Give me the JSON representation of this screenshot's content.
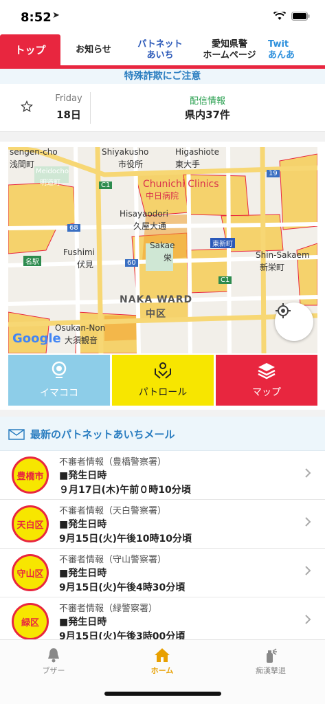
{
  "status": {
    "time": "8:52",
    "location_icon": "location-arrow-icon",
    "wifi_icon": "wifi-icon",
    "battery_icon": "battery-icon"
  },
  "tabs": [
    {
      "l1": "トップ",
      "l2": ""
    },
    {
      "l1": "お知らせ",
      "l2": ""
    },
    {
      "l1": "パトネット",
      "l2": "あいち"
    },
    {
      "l1": "愛知県警",
      "l2": "ホームページ"
    },
    {
      "l1": "Twit",
      "l2": "あんあ"
    }
  ],
  "alert": "特殊詐欺にご注意",
  "info": {
    "day": "Friday",
    "date": "18日",
    "delivery_label": "配信情報",
    "delivery_count": "県内37件"
  },
  "map": {
    "labels": {
      "sengen": "sengen-cho",
      "asama": "浅間町",
      "meidocho": "Meidocho",
      "meidocho_jp": "明道町",
      "shiyakusho": "Shiyakusho",
      "shiyakusho_jp": "市役所",
      "higashi": "Higashiote",
      "higashi_jp": "東大手",
      "chunichi": "Chunichi Clinics",
      "chunichi_jp": "中日病院",
      "c1": "C1",
      "r19": "19",
      "hisaya": "Hisayaodori",
      "hisaya_jp": "久屋大通",
      "r68": "68",
      "fushimi": "Fushimi",
      "fushimi_jp": "伏見",
      "sakae": "Sakae",
      "sakae_jp": "栄",
      "r60": "60",
      "shinsakae": "Shin-Sakaem",
      "shinsakae_jp": "新栄町",
      "shinsakae_jp2": "東新町",
      "meieki": "名駅",
      "nakaward": "NAKA WARD",
      "nakaward_jp": "中区",
      "osukan": "Osukan-Non",
      "osukan_jp": "大須観音",
      "c1b": "C1",
      "google": "Google"
    },
    "colors": {
      "area": "#f5c842",
      "area_dark": "#f0a030",
      "border": "#e8263f",
      "road": "#ffffff",
      "highway": "#f7d774"
    }
  },
  "actions": [
    {
      "label": "イマココ",
      "icon": "pin-icon"
    },
    {
      "label": "パトロール",
      "icon": "patrol-hands-icon"
    },
    {
      "label": "マップ",
      "icon": "layers-icon"
    }
  ],
  "mail": {
    "title": "最新のパトネットあいちメール",
    "items": [
      {
        "badge": "豊橋市",
        "src": "不審者情報（豊橋警察署）",
        "l1": "■発生日時",
        "l2": "９月17日(木)午前０時10分頃"
      },
      {
        "badge": "天白区",
        "src": "不審者情報（天白警察署）",
        "l1": "■発生日時",
        "l2": "9月15日(火)午後10時10分頃"
      },
      {
        "badge": "守山区",
        "src": "不審者情報（守山警察署）",
        "l1": "■発生日時",
        "l2": "9月15日(火)午後4時30分頃"
      },
      {
        "badge": "緑区",
        "src": "不審者情報（緑警察署）",
        "l1": "■発生日時",
        "l2": "9月15日(火)午後3時00分頃"
      }
    ]
  },
  "bottom": [
    {
      "label": "ブザー",
      "icon": "bell-icon"
    },
    {
      "label": "ホーム",
      "icon": "home-icon"
    },
    {
      "label": "痴漢撃退",
      "icon": "spray-icon"
    }
  ],
  "accent": "#e8263f"
}
